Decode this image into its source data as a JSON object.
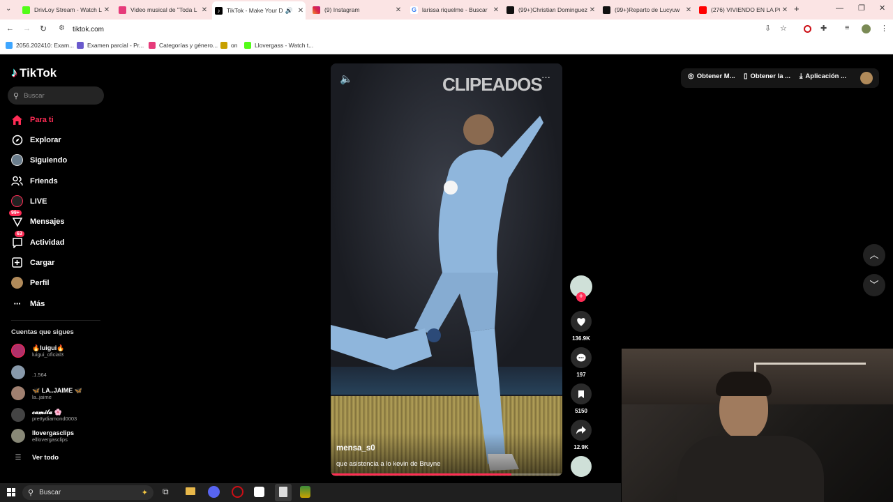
{
  "browser": {
    "tabs": [
      {
        "title": "DrivLoy Stream - Watch L",
        "color": "#53fc18"
      },
      {
        "title": "Video musical de \"Toda L",
        "color": "#e63b7a"
      },
      {
        "title": "TikTok - Make Your D",
        "color": "#000000",
        "active": true
      },
      {
        "title": "(9) Instagram",
        "color": "#d6249f"
      },
      {
        "title": "larissa riquelme - Buscar",
        "color": "#4285f4"
      },
      {
        "title": "(99+)Christian Dominguez",
        "color": "#111111"
      },
      {
        "title": "(99+)Reparto de Lucyuw",
        "color": "#111111"
      },
      {
        "title": "(276) VIVIENDO EN LA PO",
        "color": "#ff0000"
      }
    ],
    "new_tab": "+",
    "url": "tiktok.com",
    "bookmarks": [
      {
        "label": "2056.202410: Exam...",
        "color": "#3ea6ff"
      },
      {
        "label": "Examen parcial - Pr...",
        "color": "#6a5acd"
      },
      {
        "label": "Categorías y género...",
        "color": "#e63b7a"
      },
      {
        "label": "on",
        "color": "#c8a000"
      },
      {
        "label": "Llovergass - Watch t...",
        "color": "#53fc18"
      }
    ]
  },
  "tiktok": {
    "logo": "TikTok",
    "search_placeholder": "Buscar",
    "nav": [
      {
        "label": "Para ti",
        "icon": "home-icon",
        "active": true
      },
      {
        "label": "Explorar",
        "icon": "compass-icon"
      },
      {
        "label": "Siguiendo",
        "icon": "following-avatar-icon"
      },
      {
        "label": "Friends",
        "icon": "friends-icon"
      },
      {
        "label": "LIVE",
        "icon": "live-icon"
      },
      {
        "label": "Mensajes",
        "icon": "messages-icon",
        "badge": "99+"
      },
      {
        "label": "Actividad",
        "icon": "activity-icon",
        "badge": "63"
      },
      {
        "label": "Cargar",
        "icon": "upload-icon"
      },
      {
        "label": "Perfil",
        "icon": "profile-icon"
      },
      {
        "label": "Más",
        "icon": "more-icon"
      }
    ],
    "following_header": "Cuentas que sigues",
    "following": [
      {
        "name": "🔥luigui🔥",
        "handle": "luigui_oficial3",
        "color": "#b0306a"
      },
      {
        "name": "",
        "handle": ".1.564",
        "color": "#8899aa"
      },
      {
        "name": "🦋 LA..JAIME 🦋",
        "handle": "la..jaime",
        "color": "#a08070"
      },
      {
        "name": "𝓬𝓪𝓶𝓲𝓵𝓪 🌸",
        "handle": "prettydiamond0003",
        "color": "#444444"
      },
      {
        "name": "llovergasclips",
        "handle": "elllovergasclips",
        "color": "#888877"
      }
    ],
    "see_all": "Ver todo",
    "top_buttons": [
      {
        "label": "Obtener M...",
        "icon": "coin-icon"
      },
      {
        "label": "Obtener la ...",
        "icon": "phone-icon"
      },
      {
        "label": "Aplicación ...",
        "icon": "download-icon"
      }
    ],
    "video": {
      "watermark": "CLIPEADOS",
      "author": "mensa_s0",
      "caption": "que asistencia a lo kevin de Bruyne",
      "progress": 0.78
    },
    "actions": {
      "likes": "136.9K",
      "comments": "197",
      "saves": "5150",
      "shares": "12.9K"
    }
  },
  "taskbar": {
    "search": "Buscar"
  }
}
